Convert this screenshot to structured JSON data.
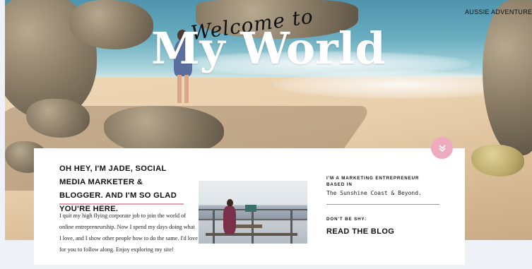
{
  "hero": {
    "script_title": "Welcome to",
    "main_title": "My World",
    "site_name": "AUSSIE ADVENTURES"
  },
  "scroll_icon": "double-chevron-down-icon",
  "intro": {
    "heading": "OH HEY, I'M JADE, SOCIAL MEDIA MARKETER & BLOGGER. AND I'M SO GLAD YOU'RE HERE.",
    "body": "I quit my high flying corporate job to join the world of online entrepreneurship. Now I spend my days doing what I love, and I show other people how to do the same. I'd love for you to follow along. Enjoy exploring my site!"
  },
  "about": {
    "kicker": "I'M A MARKETING ENTREPRENEUR BASED IN",
    "place": "The Sunshine Coast & Beyond.",
    "shy": "DON'T BE SHY:",
    "blog_link": "READ THE BLOG"
  },
  "colors": {
    "accent_pink": "#eeaabf",
    "rule_pink": "#e5a0b8",
    "text": "#111111"
  }
}
